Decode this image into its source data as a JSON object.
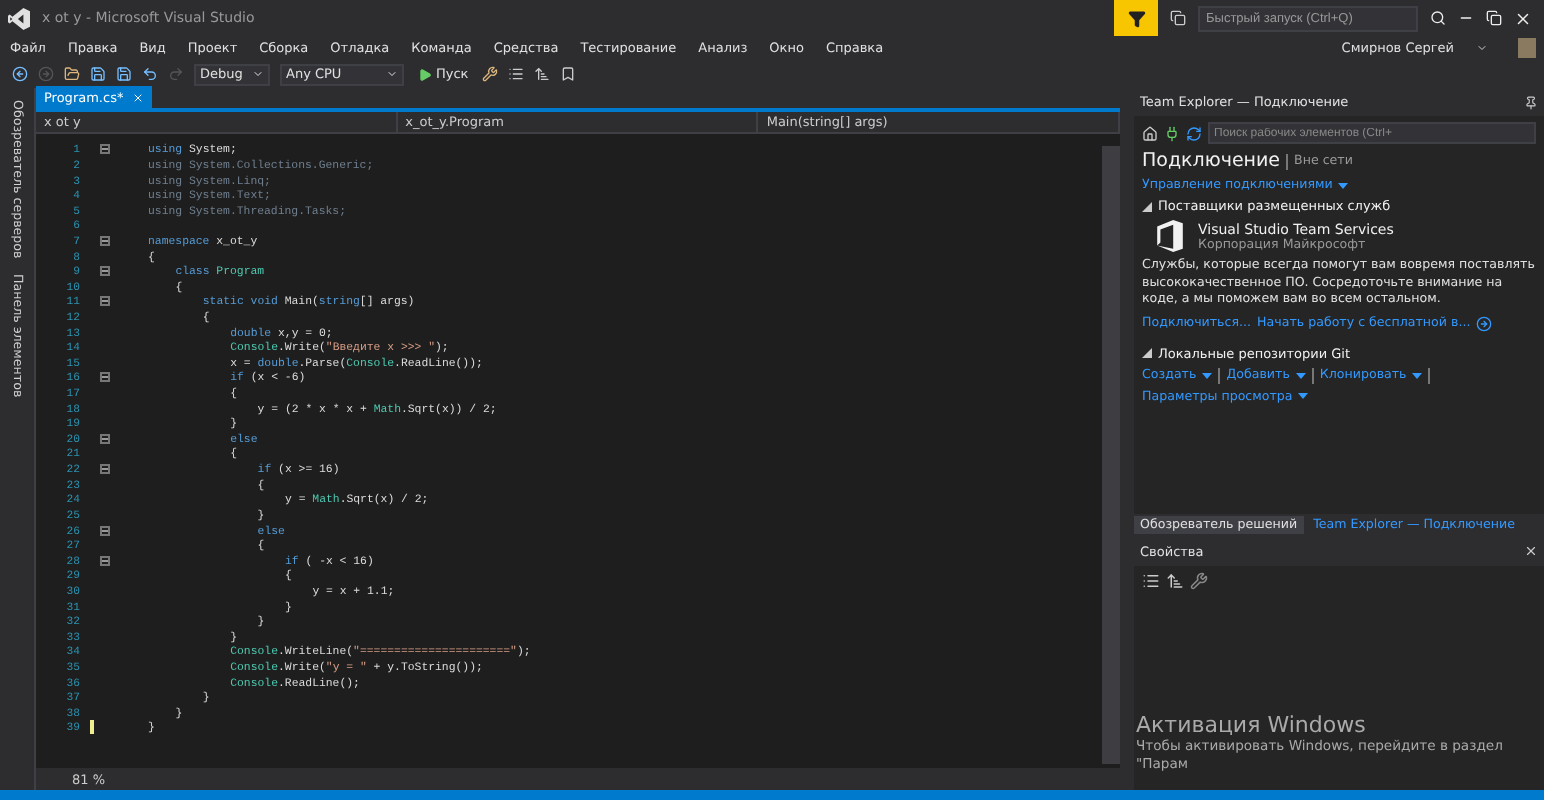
{
  "window": {
    "title": "x ot y - Microsoft Visual Studio",
    "quick_launch": {
      "placeholder": "Быстрый запуск (Ctrl+Q)"
    }
  },
  "menu": [
    "Файл",
    "Правка",
    "Вид",
    "Проект",
    "Сборка",
    "Отладка",
    "Команда",
    "Средства",
    "Тестирование",
    "Анализ",
    "Окно",
    "Справка"
  ],
  "user": "Смирнов Сергей",
  "toolbar": {
    "configuration": "Debug",
    "platform": "Any CPU",
    "start": "Пуск"
  },
  "side_tabs": [
    "Обозреватель серверов",
    "Панель элементов"
  ],
  "editor": {
    "tabs": [
      {
        "label": "Program.cs*",
        "selected": true
      }
    ],
    "nav": [
      "x ot y",
      "x_ot_y.Program",
      "Main(string[] args)"
    ],
    "zoom": "81 %",
    "lines": [
      {
        "n": "1",
        "fold": true,
        "current": false,
        "segs": [
          {
            "kind": "keyword",
            "text": "using"
          },
          {
            "kind": "plain",
            "text": " System;"
          }
        ]
      },
      {
        "n": "2",
        "fold": false,
        "current": false,
        "segs": [
          {
            "kind": "dim",
            "text": "using System.Collections.Generic;"
          }
        ]
      },
      {
        "n": "3",
        "fold": false,
        "current": false,
        "segs": [
          {
            "kind": "dim",
            "text": "using System.Linq;"
          }
        ]
      },
      {
        "n": "4",
        "fold": false,
        "current": false,
        "segs": [
          {
            "kind": "dim",
            "text": "using System.Text;"
          }
        ]
      },
      {
        "n": "5",
        "fold": false,
        "current": false,
        "segs": [
          {
            "kind": "dim",
            "text": "using System.Threading.Tasks;"
          }
        ]
      },
      {
        "n": "6",
        "fold": false,
        "current": false
      },
      {
        "n": "7",
        "fold": true,
        "current": false,
        "segs": [
          {
            "kind": "keyword",
            "text": "namespace"
          },
          {
            "kind": "plain",
            "text": " x_ot_y"
          }
        ]
      },
      {
        "n": "8",
        "fold": false,
        "current": false,
        "segs": [
          {
            "kind": "plain",
            "text": "{"
          }
        ],
        "children": [
          {
            "n": "9",
            "fold": true,
            "current": false,
            "segs": [
              {
                "kind": "keyword",
                "text": "class"
              },
              {
                "kind": "type",
                "text": " Program"
              }
            ]
          },
          {
            "n": "10",
            "fold": false,
            "current": false,
            "segs": [
              {
                "kind": "plain",
                "text": "{"
              }
            ],
            "children": [
              {
                "n": "11",
                "fold": true,
                "current": false,
                "segs": [
                  {
                    "kind": "keyword",
                    "text": "static void"
                  },
                  {
                    "kind": "plain",
                    "text": " Main("
                  },
                  {
                    "kind": "keyword",
                    "text": "string"
                  },
                  {
                    "kind": "plain",
                    "text": "[] args)"
                  }
                ]
              },
              {
                "n": "12",
                "fold": false,
                "current": false,
                "segs": [
                  {
                    "kind": "plain",
                    "text": "{"
                  }
                ],
                "children": [
                  {
                    "n": "13",
                    "fold": false,
                    "current": false,
                    "segs": [
                      {
                        "kind": "keyword",
                        "text": "double"
                      },
                      {
                        "kind": "plain",
                        "text": " x,y = 0;"
                      }
                    ]
                  },
                  {
                    "n": "14",
                    "fold": false,
                    "current": false,
                    "segs": [
                      {
                        "kind": "type",
                        "text": "Console"
                      },
                      {
                        "kind": "plain",
                        "text": ".Write("
                      },
                      {
                        "kind": "string",
                        "text": "\"Введите x >>> \""
                      },
                      {
                        "kind": "plain",
                        "text": ");"
                      }
                    ]
                  },
                  {
                    "n": "15",
                    "fold": false,
                    "current": false,
                    "segs": [
                      {
                        "kind": "plain",
                        "text": "x = "
                      },
                      {
                        "kind": "keyword",
                        "text": "double"
                      },
                      {
                        "kind": "plain",
                        "text": ".Parse("
                      },
                      {
                        "kind": "type",
                        "text": "Console"
                      },
                      {
                        "kind": "plain",
                        "text": ".ReadLine());"
                      }
                    ]
                  },
                  {
                    "n": "16",
                    "fold": true,
                    "current": false,
                    "segs": [
                      {
                        "kind": "keyword",
                        "text": "if"
                      },
                      {
                        "kind": "plain",
                        "text": " (x < -6)"
                      }
                    ]
                  },
                  {
                    "n": "17",
                    "fold": false,
                    "current": false,
                    "segs": [
                      {
                        "kind": "plain",
                        "text": "{"
                      }
                    ],
                    "children": [
                      {
                        "n": "18",
                        "fold": false,
                        "current": false,
                        "segs": [
                          {
                            "kind": "plain",
                            "text": "y = (2 * x * x + "
                          },
                          {
                            "kind": "type",
                            "text": "Math"
                          },
                          {
                            "kind": "plain",
                            "text": ".Sqrt(x)) / 2;"
                          }
                        ]
                      }
                    ]
                  },
                  {
                    "n": "19",
                    "fold": false,
                    "current": false,
                    "segs": [
                      {
                        "kind": "plain",
                        "text": "}"
                      }
                    ]
                  },
                  {
                    "n": "20",
                    "fold": true,
                    "current": false,
                    "segs": [
                      {
                        "kind": "keyword",
                        "text": "else"
                      }
                    ]
                  },
                  {
                    "n": "21",
                    "fold": false,
                    "current": false,
                    "segs": [
                      {
                        "kind": "plain",
                        "text": "{"
                      }
                    ],
                    "children": [
                      {
                        "n": "22",
                        "fold": true,
                        "current": false,
                        "segs": [
                          {
                            "kind": "keyword",
                            "text": "if"
                          },
                          {
                            "kind": "plain",
                            "text": " (x >= 16)"
                          }
                        ]
                      },
                      {
                        "n": "23",
                        "fold": false,
                        "current": false,
                        "segs": [
                          {
                            "kind": "plain",
                            "text": "{"
                          }
                        ],
                        "children": [
                          {
                            "n": "24",
                            "fold": false,
                            "current": false,
                            "segs": [
                              {
                                "kind": "plain",
                                "text": "y = "
                              },
                              {
                                "kind": "type",
                                "text": "Math"
                              },
                              {
                                "kind": "plain",
                                "text": ".Sqrt(x) / 2;"
                              }
                            ]
                          }
                        ]
                      },
                      {
                        "n": "25",
                        "fold": false,
                        "current": false,
                        "segs": [
                          {
                            "kind": "plain",
                            "text": "}"
                          }
                        ]
                      },
                      {
                        "n": "26",
                        "fold": true,
                        "current": false,
                        "segs": [
                          {
                            "kind": "keyword",
                            "text": "else"
                          }
                        ]
                      },
                      {
                        "n": "27",
                        "fold": false,
                        "current": false,
                        "segs": [
                          {
                            "kind": "plain",
                            "text": "{"
                          }
                        ],
                        "children": [
                          {
                            "n": "28",
                            "fold": true,
                            "current": false,
                            "segs": [
                              {
                                "kind": "keyword",
                                "text": "if"
                              },
                              {
                                "kind": "plain",
                                "text": " ( -x < 16)"
                              }
                            ]
                          },
                          {
                            "n": "29",
                            "fold": false,
                            "current": false,
                            "segs": [
                              {
                                "kind": "plain",
                                "text": "{"
                              }
                            ],
                            "children": [
                              {
                                "n": "30",
                                "fold": false,
                                "current": false,
                                "segs": [
                                  {
                                    "kind": "plain",
                                    "text": "y = x + 1.1;"
                                  }
                                ]
                              }
                            ]
                          },
                          {
                            "n": "31",
                            "fold": false,
                            "current": false,
                            "segs": [
                              {
                                "kind": "plain",
                                "text": "}"
                              }
                            ]
                          }
                        ]
                      },
                      {
                        "n": "32",
                        "fold": false,
                        "current": false,
                        "segs": [
                          {
                            "kind": "plain",
                            "text": "}"
                          }
                        ]
                      }
                    ]
                  },
                  {
                    "n": "33",
                    "fold": false,
                    "current": false,
                    "segs": [
                      {
                        "kind": "plain",
                        "text": "}"
                      }
                    ]
                  },
                  {
                    "n": "34",
                    "fold": false,
                    "current": false,
                    "segs": [
                      {
                        "kind": "type",
                        "text": "Console"
                      },
                      {
                        "kind": "plain",
                        "text": ".WriteLine("
                      },
                      {
                        "kind": "string",
                        "text": "\"======================\""
                      },
                      {
                        "kind": "plain",
                        "text": ");"
                      }
                    ]
                  },
                  {
                    "n": "35",
                    "fold": false,
                    "current": false,
                    "segs": [
                      {
                        "kind": "type",
                        "text": "Console"
                      },
                      {
                        "kind": "plain",
                        "text": ".Write("
                      },
                      {
                        "kind": "string",
                        "text": "\"y = \""
                      },
                      {
                        "kind": "plain",
                        "text": " + y.ToString());"
                      }
                    ]
                  },
                  {
                    "n": "36",
                    "fold": false,
                    "current": false,
                    "segs": [
                      {
                        "kind": "type",
                        "text": "Console"
                      },
                      {
                        "kind": "plain",
                        "text": ".ReadLine();"
                      }
                    ]
                  }
                ]
              },
              {
                "n": "37",
                "fold": false,
                "current": false,
                "segs": [
                  {
                    "kind": "plain",
                    "text": "}"
                  }
                ]
              }
            ]
          },
          {
            "n": "38",
            "fold": false,
            "current": false,
            "segs": [
              {
                "kind": "plain",
                "text": "}"
              }
            ]
          }
        ]
      },
      {
        "n": "39",
        "fold": false,
        "current": true,
        "segs": [
          {
            "kind": "plain",
            "text": "}"
          }
        ]
      }
    ]
  },
  "team_explorer": {
    "title": "Team Explorer — Подключение",
    "search": {
      "placeholder": "Поиск рабочих элементов (Ctrl+"
    },
    "heading": "Подключение",
    "status": "Вне сети",
    "manage_link": "Управление подключениями",
    "hosted": {
      "title": "Поставщики размещенных служб",
      "expanded": true,
      "service": "Visual Studio Team Services",
      "company": "Корпорация Майкрософт",
      "description": "Службы, которые всегда помогут вам вовремя поставлять высококачественное ПО. Сосредоточьте внимание на коде, а мы поможем вам во всем остальном.",
      "links": [
        "Подключиться...",
        "Начать работу с бесплатной в..."
      ]
    },
    "git": {
      "title": "Локальные репозитории Git",
      "expanded": true,
      "actions": [
        "Создать",
        "Добавить",
        "Клонировать"
      ],
      "options": "Параметры просмотра"
    }
  },
  "panel_tabs": [
    {
      "label": "Обозреватель решений",
      "selected": false
    },
    {
      "label": "Team Explorer — Подключение",
      "selected": true
    }
  ],
  "properties": {
    "title": "Свойства"
  },
  "activation": {
    "title": "Активация Windows",
    "text": "Чтобы активировать Windows, перейдите в раздел \"Парам"
  }
}
